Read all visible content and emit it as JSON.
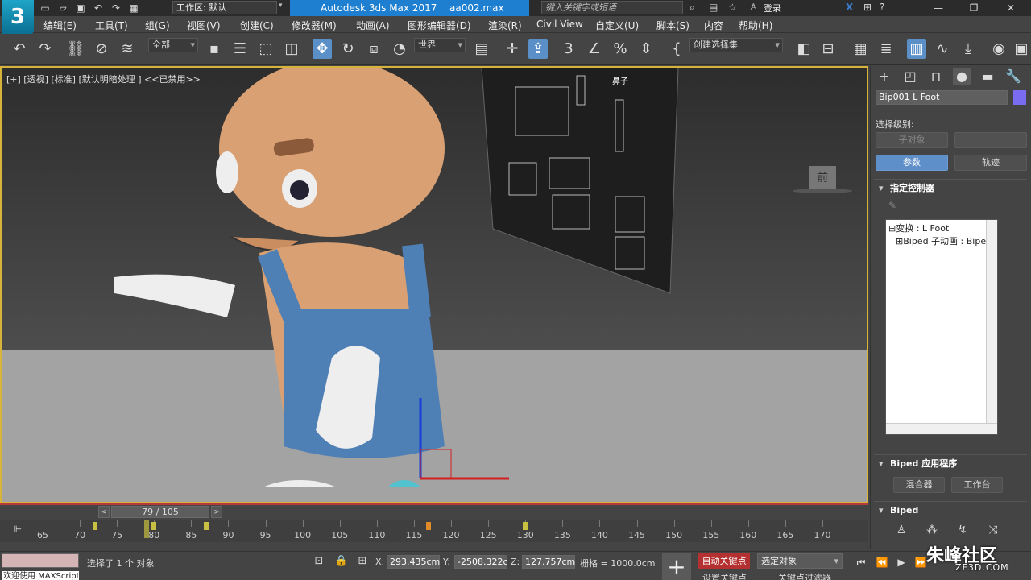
{
  "titlebar": {
    "logo": "3",
    "workspace_label": "工作区: 默认",
    "app_title": "Autodesk 3ds Max 2017",
    "file_name": "aa002.max",
    "search_placeholder": "键入关键字或短语",
    "login_label": "登录",
    "help_label": "?"
  },
  "menu": {
    "items": [
      "编辑(E)",
      "工具(T)",
      "组(G)",
      "视图(V)",
      "创建(C)",
      "修改器(M)",
      "动画(A)",
      "图形编辑器(D)",
      "渲染(R)",
      "Civil View",
      "自定义(U)",
      "脚本(S)",
      "内容",
      "帮助(H)"
    ]
  },
  "toolbar": {
    "filter_value": "全部",
    "coord_system": "世界",
    "selection_set": "创建选择集"
  },
  "viewport": {
    "label": "[+] [透视] [标准] [默认明暗处理 ] <<已禁用>>",
    "viewcube_label": "前",
    "sign_text": "鼻子"
  },
  "command_panel": {
    "object_name": "Bip001 L Foot",
    "object_color": "#7a6cf0",
    "selection_level_label": "选择级别:",
    "sub_object_button": "子对象",
    "params_button": "参数",
    "track_button": "轨迹",
    "assign_controller_title": "指定控制器",
    "tree_rows": [
      "⊟变换 : L Foot",
      "⊞Biped 子动画 : Biped"
    ],
    "biped_apps_title": "Biped 应用程序",
    "mixer_button": "混合器",
    "workbench_button": "工作台",
    "biped_title": "Biped"
  },
  "timeline": {
    "frame_display": "79 / 105",
    "current_frame": 79,
    "range_start": 65,
    "range_end": 170,
    "tick_labels": [
      "65",
      "70",
      "75",
      "80",
      "85",
      "90",
      "95",
      "100",
      "105",
      "110",
      "115",
      "120",
      "125",
      "130",
      "135",
      "140",
      "145",
      "150",
      "155",
      "160",
      "165",
      "170"
    ],
    "key_frames": [
      72,
      80,
      87,
      117,
      130
    ]
  },
  "statusbar": {
    "maxscript_text": "欢迎使用 MAXScript",
    "status_text": "选择了 1 个 对象",
    "x_label": "X:",
    "x_value": "293.435cm",
    "y_label": "Y:",
    "y_value": "-2508.322c",
    "z_label": "Z:",
    "z_value": "127.757cm",
    "grid_label": "栅格 = 1000.0cm",
    "autokey_label": "自动关键点",
    "set_key_label": "设置关键点",
    "selected_object": "选定对象",
    "key_filter_label": "关键点过滤器"
  },
  "watermark": {
    "brand": "朱峰社区",
    "url": "ZF3D.COM"
  }
}
